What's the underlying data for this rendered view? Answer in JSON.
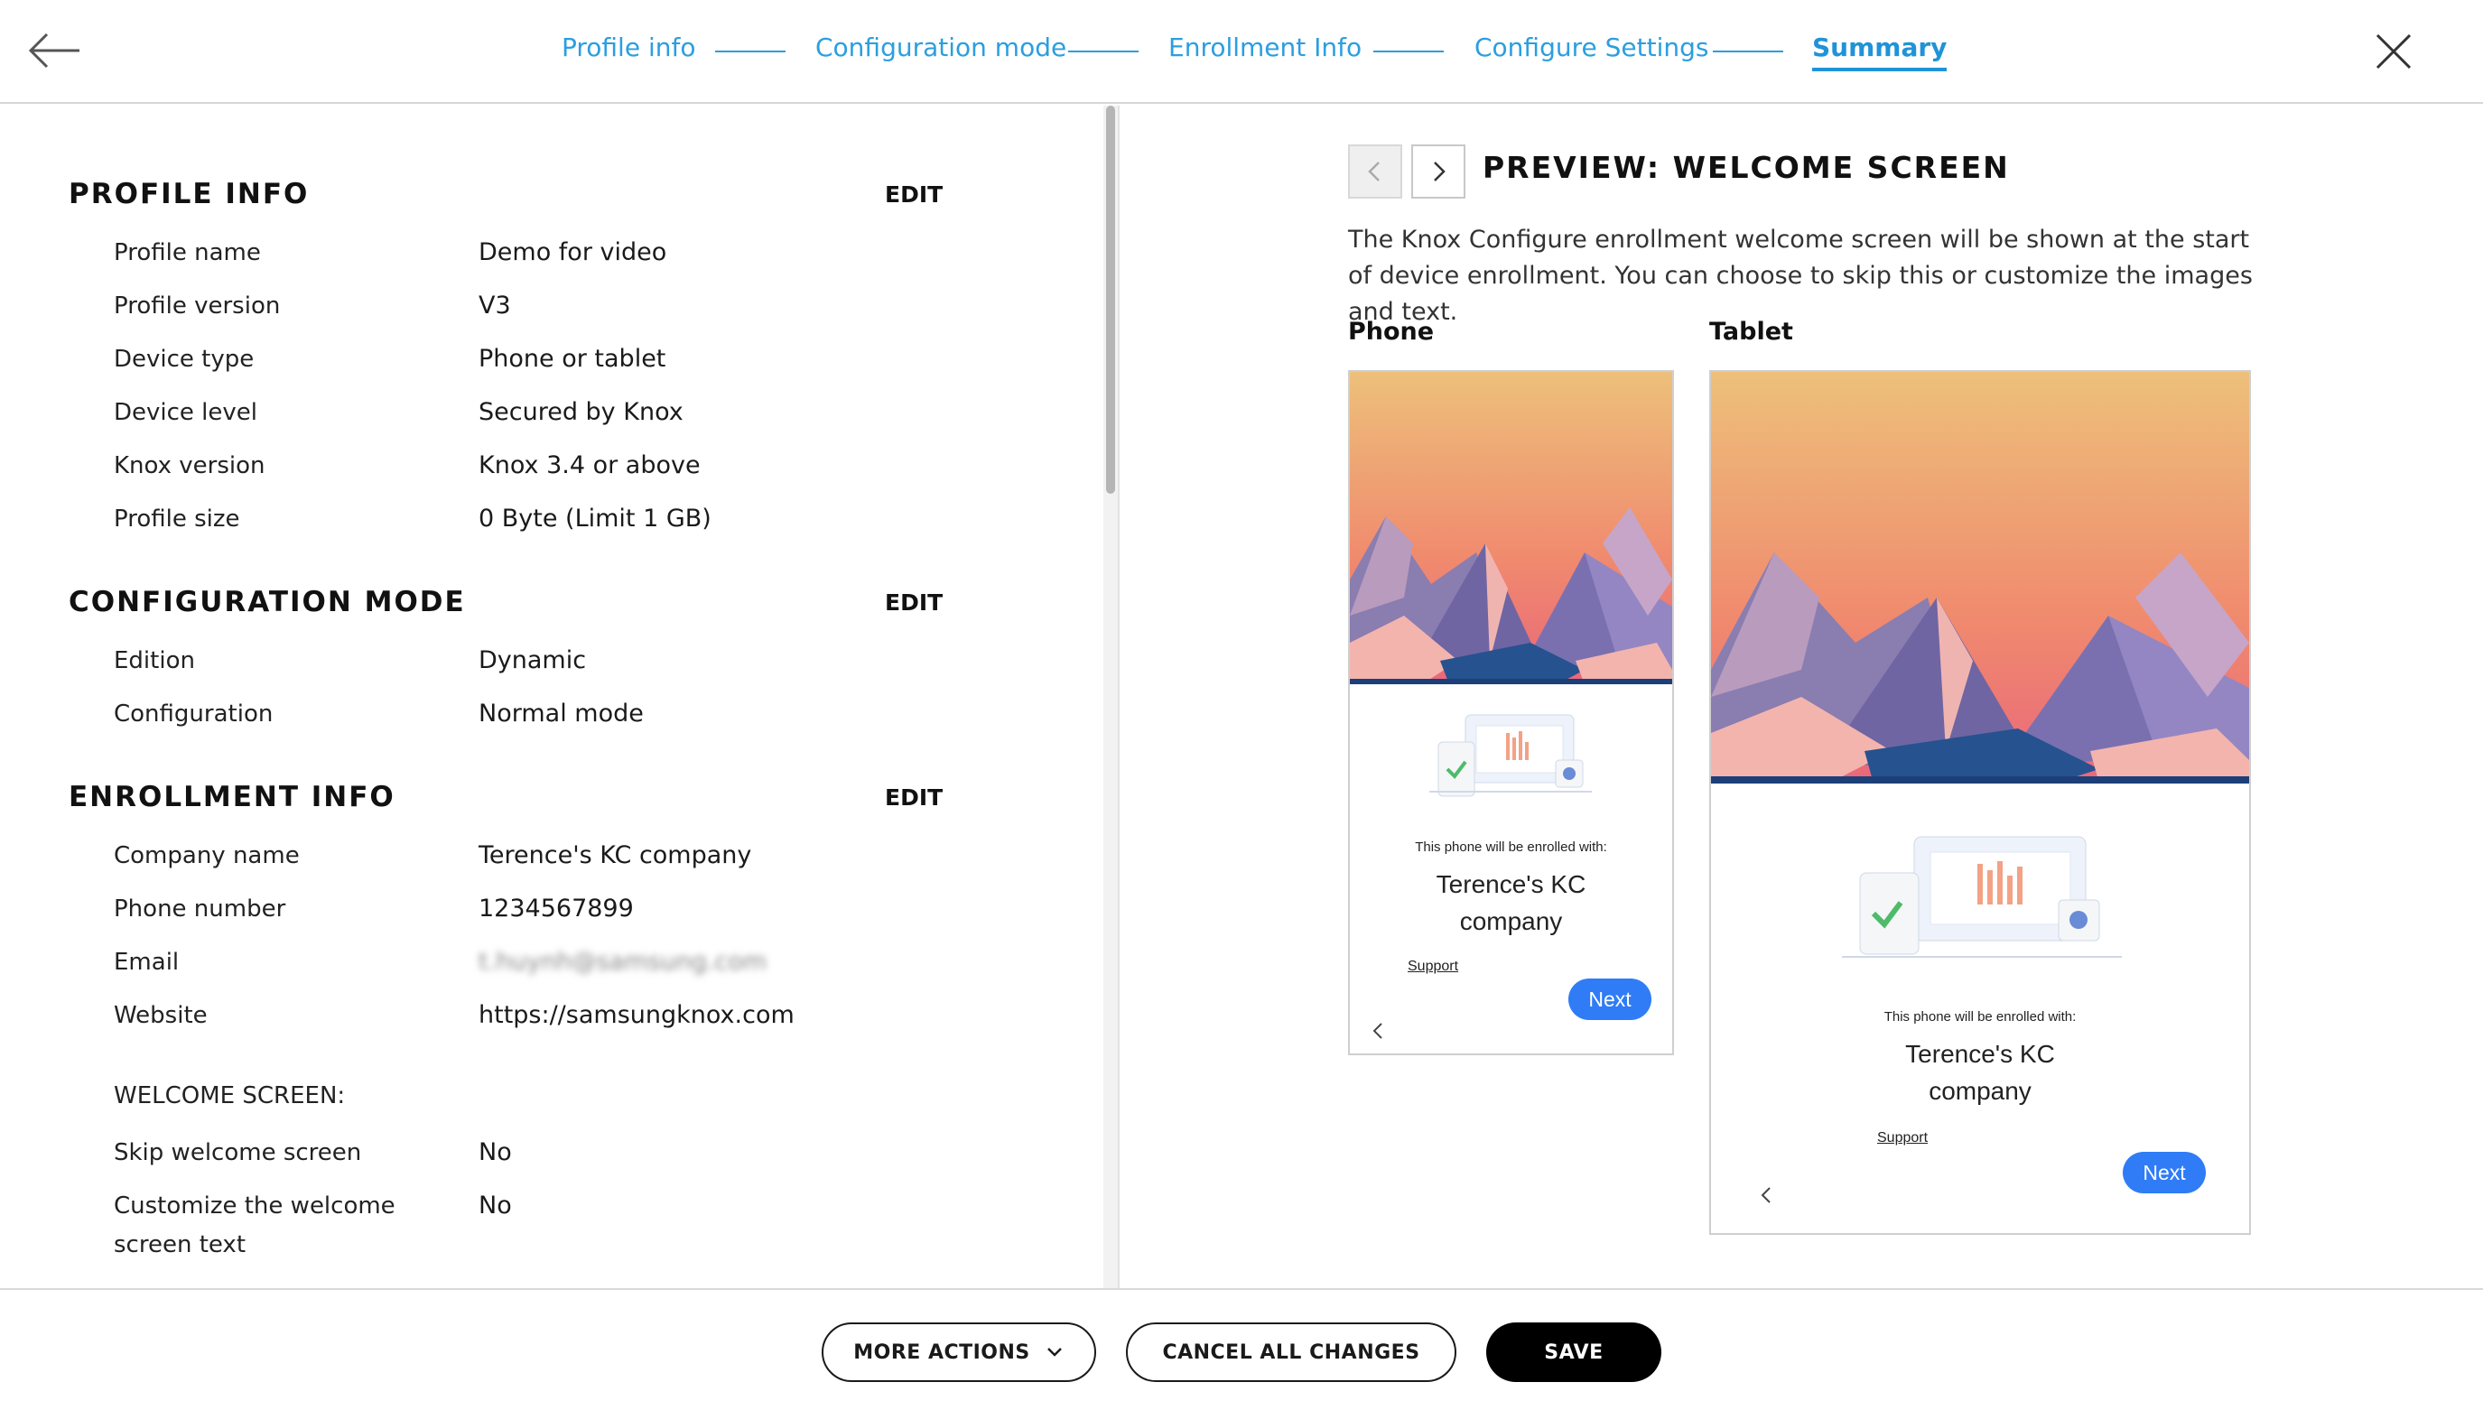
{
  "header": {
    "steps": [
      {
        "label": "Profile info"
      },
      {
        "label": "Configuration mode"
      },
      {
        "label": "Enrollment Info"
      },
      {
        "label": "Configure Settings"
      },
      {
        "label": "Summary",
        "active": true
      }
    ]
  },
  "summary": {
    "edit_label": "EDIT",
    "profile_info": {
      "title": "PROFILE INFO",
      "rows": [
        {
          "label": "Profile name",
          "value": "Demo for video"
        },
        {
          "label": "Profile version",
          "value": "V3"
        },
        {
          "label": "Device type",
          "value": "Phone or tablet"
        },
        {
          "label": "Device level",
          "value": "Secured by Knox"
        },
        {
          "label": "Knox version",
          "value": "Knox 3.4 or above"
        },
        {
          "label": "Profile size",
          "value": "0 Byte (Limit 1 GB)"
        }
      ]
    },
    "configuration_mode": {
      "title": "CONFIGURATION MODE",
      "rows": [
        {
          "label": "Edition",
          "value": "Dynamic"
        },
        {
          "label": "Configuration",
          "value": "Normal mode"
        }
      ]
    },
    "enrollment_info": {
      "title": "ENROLLMENT INFO",
      "rows": [
        {
          "label": "Company name",
          "value": "Terence's KC company"
        },
        {
          "label": "Phone number",
          "value": "1234567899"
        },
        {
          "label": "Email",
          "value": "t.huynh@samsung.com"
        },
        {
          "label": "Website",
          "value": "https://samsungknox.com"
        }
      ],
      "welcome_heading": "WELCOME SCREEN:",
      "welcome_rows": [
        {
          "label": "Skip welcome screen",
          "value": "No"
        },
        {
          "label": "Customize the welcome",
          "label2": "screen text",
          "value": "No"
        }
      ]
    }
  },
  "preview": {
    "title": "PREVIEW: WELCOME SCREEN",
    "description": "The Knox Configure enrollment welcome screen will be shown at the start of device enrollment. You can choose to skip this or customize the images and text.",
    "phone_label": "Phone",
    "tablet_label": "Tablet",
    "enrolled_text": "This phone will be enrolled with:",
    "company_line1": "Terence's KC",
    "company_line2": "company",
    "support": "Support",
    "next": "Next"
  },
  "footer": {
    "more_actions": "MORE ACTIONS",
    "cancel": "CANCEL ALL CHANGES",
    "save": "SAVE"
  },
  "colors": {
    "accent": "#2b9ee0",
    "next_button": "#2f7cf6",
    "save_button": "#000000"
  }
}
